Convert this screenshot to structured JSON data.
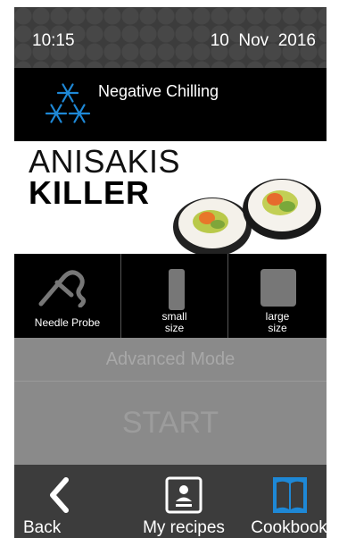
{
  "status": {
    "time": "10:15",
    "date": "10  Nov  2016"
  },
  "mode": {
    "label": "Negative Chilling",
    "icon": "snowflakes-icon"
  },
  "banner": {
    "line1": "ANISAKIS",
    "line2": "KILLER"
  },
  "options": {
    "needle_probe": "Needle Probe",
    "small_size": "small\nsize",
    "large_size": "large\nsize"
  },
  "advanced_mode": "Advanced Mode",
  "start": "START",
  "nav": {
    "back": "Back",
    "recipes": "My recipes",
    "cookbook": "Cookbook"
  },
  "colors": {
    "accent": "#1e88d6",
    "dark": "#3c3c3c",
    "disabled": "#8a8a8a"
  }
}
